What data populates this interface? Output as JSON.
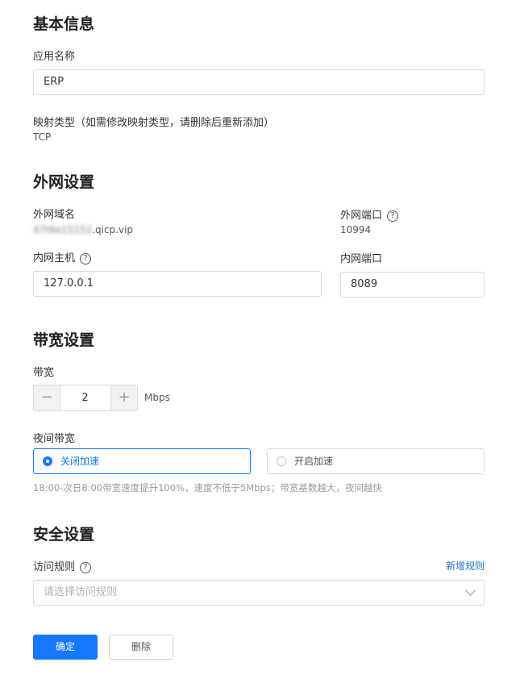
{
  "basic": {
    "title": "基本信息",
    "app_name_label": "应用名称",
    "app_name_value": "ERP",
    "mapping_type_label": "映射类型（如需修改映射类型，请删除后重新添加）",
    "mapping_type_value": "TCP"
  },
  "external": {
    "title": "外网设置",
    "domain_label": "外网域名",
    "domain_value_prefix": "47t6e15152",
    "domain_value_suffix": ".qicp.vip",
    "port_label": "外网端口",
    "port_value": "10994",
    "host_label": "内网主机",
    "host_value": "127.0.0.1",
    "internal_port_label": "内网端口",
    "internal_port_value": "8089"
  },
  "bandwidth": {
    "title": "带宽设置",
    "label": "带宽",
    "value": "2",
    "unit": "Mbps",
    "night_label": "夜间带宽",
    "options": [
      {
        "label": "关闭加速",
        "selected": true
      },
      {
        "label": "开启加速",
        "selected": false
      }
    ],
    "hint": "18:00-次日8:00带宽速度提升100%，速度不低于5Mbps；带宽基数越大，夜间越快"
  },
  "security": {
    "title": "安全设置",
    "rules_label": "访问规则",
    "add_rule_link": "新增规则",
    "select_placeholder": "请选择访问规则"
  },
  "actions": {
    "confirm": "确定",
    "delete": "删除"
  },
  "colors": {
    "primary": "#1677ff",
    "link": "#1a73c8"
  }
}
